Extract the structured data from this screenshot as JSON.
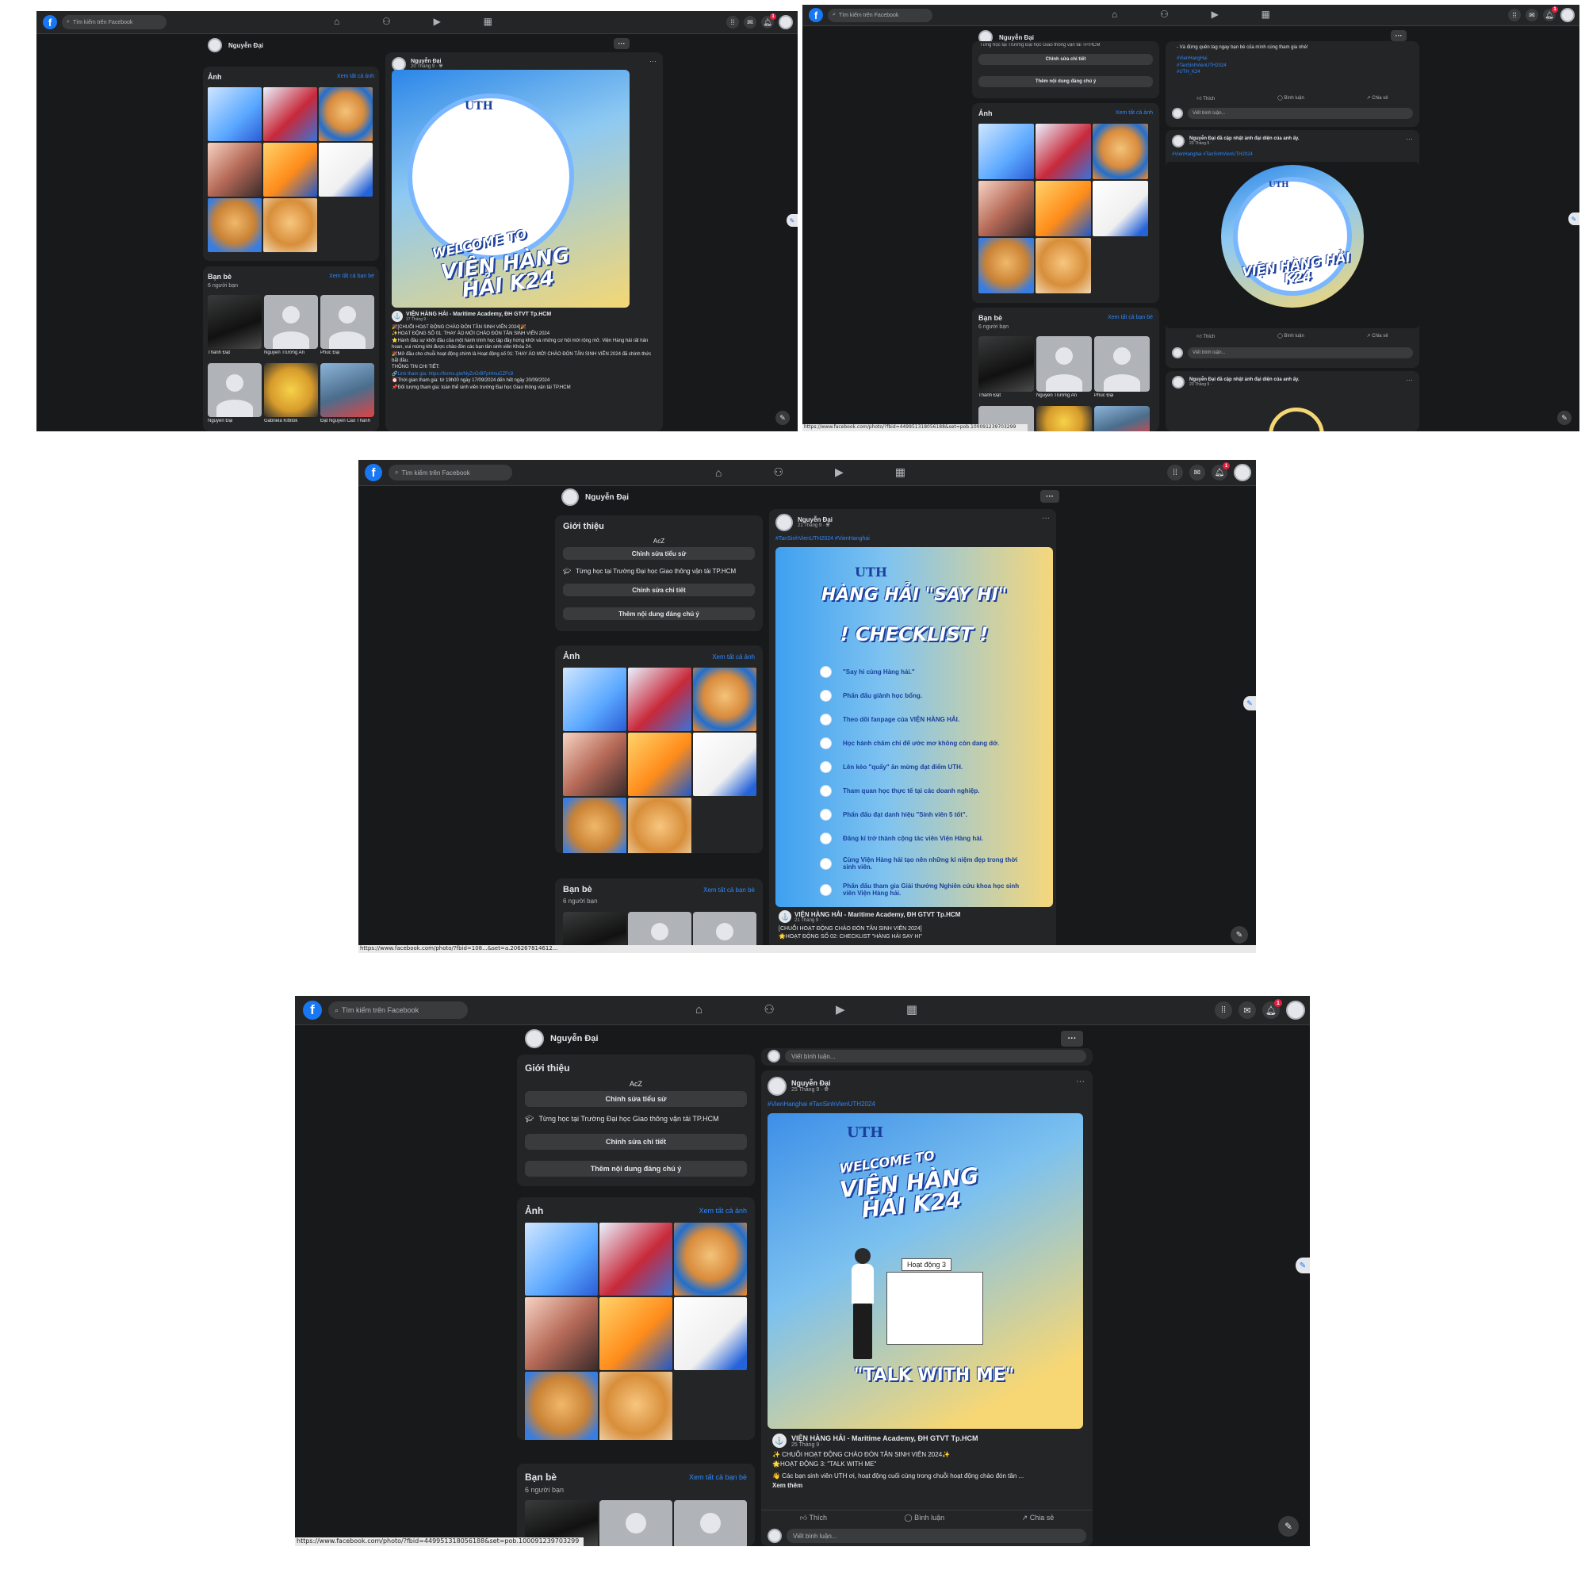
{
  "app": {
    "logo": "f",
    "search_placeholder": "Tìm kiếm trên Facebook",
    "nav_icons": [
      "home-icon",
      "friends-icon",
      "watch-icon",
      "marketplace-icon"
    ],
    "notification_count": "1"
  },
  "profile": {
    "name": "Nguyễn Đại"
  },
  "intro": {
    "title": "Giới thiệu",
    "bio": "AcZ",
    "edit_bio": "Chỉnh sửa tiểu sử",
    "study": "Từng học tại Trường Đại học Giao thông vận tải TP.HCM",
    "edit_details": "Chỉnh sửa chi tiết",
    "add_featured": "Thêm nội dung đáng chú ý"
  },
  "photos": {
    "title": "Ảnh",
    "see_all": "Xem tất cả ảnh"
  },
  "friends": {
    "title": "Bạn bè",
    "see_all": "Xem tất cả bạn bè",
    "count": "6 người bạn",
    "list": [
      {
        "name": "Thành Đạt"
      },
      {
        "name": "Nguyễn Trường An"
      },
      {
        "name": "Phúc Đại"
      },
      {
        "name": "Nguyễn Đại"
      },
      {
        "name": "Gabriela Kittitok"
      },
      {
        "name": "Đạt Nguyen Cao Thanh"
      }
    ]
  },
  "actions": {
    "like": "Thích",
    "comment": "Bình luận",
    "share": "Chia sẻ",
    "write_comment": "Viết bình luận..."
  },
  "page": {
    "name": "VIỆN HÀNG HẢI - Maritime Academy, ĐH GTVT Tp.HCM"
  },
  "shot1": {
    "post": {
      "date": "20 Tháng 9 · ",
      "poster_title": "VIỆN HÀNG HẢI K24",
      "poster_sub": "WELCOME TO",
      "shared_date": "17 Tháng 9 · ",
      "lines": [
        "🎉[CHUỖI HOẠT ĐỘNG CHÀO ĐÓN TÂN SINH VIÊN 2024]🎉",
        "✨HOẠT ĐỘNG SỐ 01: THAY ÁO MỚI CHÀO ĐÓN TÂN SINH VIÊN 2024",
        "⭐Hành đầu sự khởi đầu của một hành trình học tập đầy hứng khởi và những cơ hội mới rộng mở. Viện Hàng hải rất hân hoan, vui mừng khi được chào đón các bạn tân sinh viên Khóa 24.",
        "🎉Mở đầu cho chuỗi hoạt động chính là Hoạt động số 01: THAY ÁO MỚI CHÀO ĐÓN TÂN SINH VIÊN 2024 đã chính thức bắt đầu.",
        "THÔNG TIN CHI TIẾT:",
        "🔗Link tham gia: https://forms.gle/NyZvOrBFpHmuCZFc9",
        "⏰Thời gian tham gia: từ 19h00 ngày 17/09/2024 đến hết ngày 20/09/2024",
        "📌Đối tượng tham gia: toàn thể sinh viên trường Đại học Giao thông vận tải TP.HCM"
      ]
    }
  },
  "shot2": {
    "top_text": "- Và đừng quên tag ngay bạn bè của mình cùng tham gia nhé!",
    "top_tags": [
      "#VienHangHai",
      "#TanSinhVienUTH2024",
      "#UTH_K24"
    ],
    "post_a": {
      "author_note": "Nguyễn Đại đã cập nhật ảnh đại diện của anh ấy.",
      "date": "20 Tháng 9 · ",
      "tags": "#VienHanghai #TanSinhVienUTH2024"
    },
    "post_b": {
      "author_note": "Nguyễn Đại đã cập nhật ảnh đại diện của anh ấy.",
      "date": "20 Tháng 9 · "
    },
    "url": "https://www.facebook.com/photo/?fbid=449951318056188&set=pob.100091239703299"
  },
  "shot3": {
    "post": {
      "date": "21 Tháng 9 · ",
      "tags": "#TanSinhVienUTH2024 #VienHanghai",
      "poster_title_1": "HÀNG HẢI \"SAY HI\"",
      "poster_title_2": "! CHECKLIST !",
      "checklist": [
        "\"Say hi cùng Hàng hải.\"",
        "Phấn đấu giành học bổng.",
        "Theo dõi fanpage của VIỆN HÀNG HẢI.",
        "Học hành chăm chỉ để ước mơ không còn dang dở.",
        "Lên kèo \"quẩy\" ăn mừng đạt điểm UTH.",
        "Tham quan học thực tế tại các doanh nghiệp.",
        "Phấn đấu đạt danh hiệu \"Sinh viên 5 tốt\".",
        "Đăng kí trở thành cộng tác viên Viện Hàng hải.",
        "Cùng Viện Hàng hải tạo nên những kỉ niệm đẹp trong thời sinh viên.",
        "Phấn đấu tham gia Giải thưởng Nghiên cứu khoa học sinh viên Viện Hàng hải."
      ],
      "shared_date": "21 Tháng 9 · ",
      "lines": [
        "[CHUỖI HOẠT ĐỘNG CHÀO ĐÓN TÂN SINH VIÊN 2024]",
        "🌟HOẠT ĐỘNG SỐ 02: CHECKLIST \"HÀNG HẢI SAY HI\""
      ]
    },
    "url": "https://www.facebook.com/photo/?fbid=108...&set=a.206267814612..."
  },
  "shot4": {
    "post": {
      "date": "25 Tháng 9 · ",
      "tags": "#VienHanghai #TanSinhVienUTH2024",
      "poster_sub": "WELCOME TO",
      "poster_title": "VIỆN HÀNG HẢI K24",
      "poster_activity": "Hoạt động 3",
      "poster_bottom": "\"TALK WITH ME\"",
      "shared_date": "25 Tháng 9 · ",
      "lines": [
        "✨ CHUỖI HOẠT ĐỘNG CHÀO ĐÓN TÂN SINH VIÊN 2024✨",
        "🌟HOẠT ĐỘNG 3: \"TALK WITH ME\"",
        "👋 Các bạn sinh viên UTH ơi, hoạt động cuối cùng trong chuỗi hoạt động chào đón tân ..."
      ],
      "see_more": "Xem thêm"
    },
    "url": "https://www.facebook.com/photo/?fbid=449951318056188&set=pob.100091239703299"
  }
}
